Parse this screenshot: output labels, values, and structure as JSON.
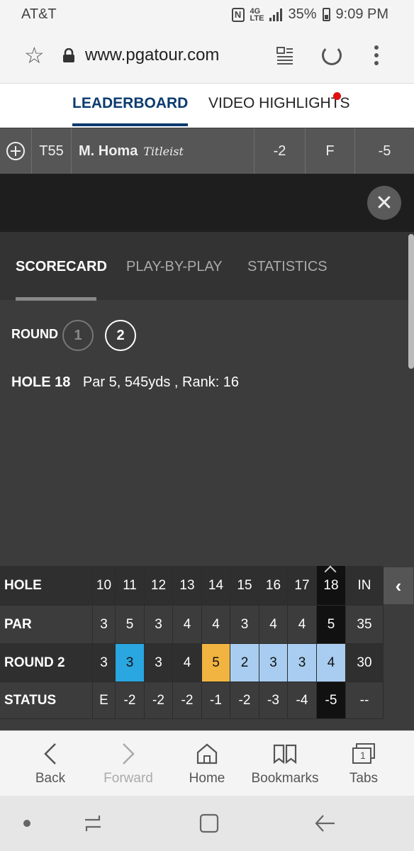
{
  "status_bar": {
    "carrier": "AT&T",
    "network": "4G LTE",
    "battery": "35%",
    "time": "9:09 PM"
  },
  "browser": {
    "url": "www.pgatour.com",
    "icons": [
      "star-icon",
      "lock-icon",
      "reader-mode-icon",
      "reload-icon",
      "more-menu-icon"
    ]
  },
  "nav_tabs": [
    {
      "label": "LEADERBOARD",
      "active": true
    },
    {
      "label": "VIDEO HIGHLIGHTS",
      "active": false,
      "has_notification": true
    }
  ],
  "player": {
    "position": "T55",
    "name": "M. Homa",
    "sponsor": "Titleist",
    "today": "-2",
    "thru": "F",
    "total": "-5"
  },
  "panel_tabs": [
    {
      "label": "SCORECARD",
      "active": true
    },
    {
      "label": "PLAY-BY-PLAY",
      "active": false
    },
    {
      "label": "STATISTICS",
      "active": false
    }
  ],
  "round_selector": {
    "label": "ROUND",
    "rounds": [
      "1",
      "2"
    ],
    "selected": "2"
  },
  "hole_info": {
    "hole": "HOLE 18",
    "details": "Par 5, 545yds , Rank: 16"
  },
  "scorecard": {
    "rows": [
      {
        "label": "HOLE",
        "cells": [
          "10",
          "11",
          "12",
          "13",
          "14",
          "15",
          "16",
          "17",
          "18",
          "IN"
        ]
      },
      {
        "label": "PAR",
        "cells": [
          "3",
          "5",
          "3",
          "4",
          "4",
          "3",
          "4",
          "4",
          "5",
          "35"
        ]
      },
      {
        "label": "ROUND 2",
        "cells": [
          "3",
          "3",
          "3",
          "4",
          "5",
          "2",
          "3",
          "3",
          "4",
          "30"
        ]
      },
      {
        "label": "STATUS",
        "cells": [
          "E",
          "-2",
          "-2",
          "-2",
          "-1",
          "-2",
          "-3",
          "-4",
          "-5",
          "--"
        ]
      }
    ],
    "score_colors": {
      "eagle": "#2aa6e0",
      "bogey": "#f2b440",
      "birdie": "#a9cdf0",
      "par": "#3a3a3a"
    },
    "round_cell_types": [
      "par",
      "eagle",
      "par",
      "par",
      "bogey",
      "birdie",
      "birdie",
      "birdie",
      "birdie",
      "total"
    ],
    "collapse_label": "‹"
  },
  "bottom_bar": [
    {
      "label": "Back",
      "icon": "back-arrow-icon",
      "enabled": true
    },
    {
      "label": "Forward",
      "icon": "forward-arrow-icon",
      "enabled": false
    },
    {
      "label": "Home",
      "icon": "home-icon",
      "enabled": true
    },
    {
      "label": "Bookmarks",
      "icon": "bookmarks-icon",
      "enabled": true
    },
    {
      "label": "Tabs",
      "icon": "tabs-icon",
      "enabled": true,
      "count": "1"
    }
  ],
  "close_label": "✕"
}
